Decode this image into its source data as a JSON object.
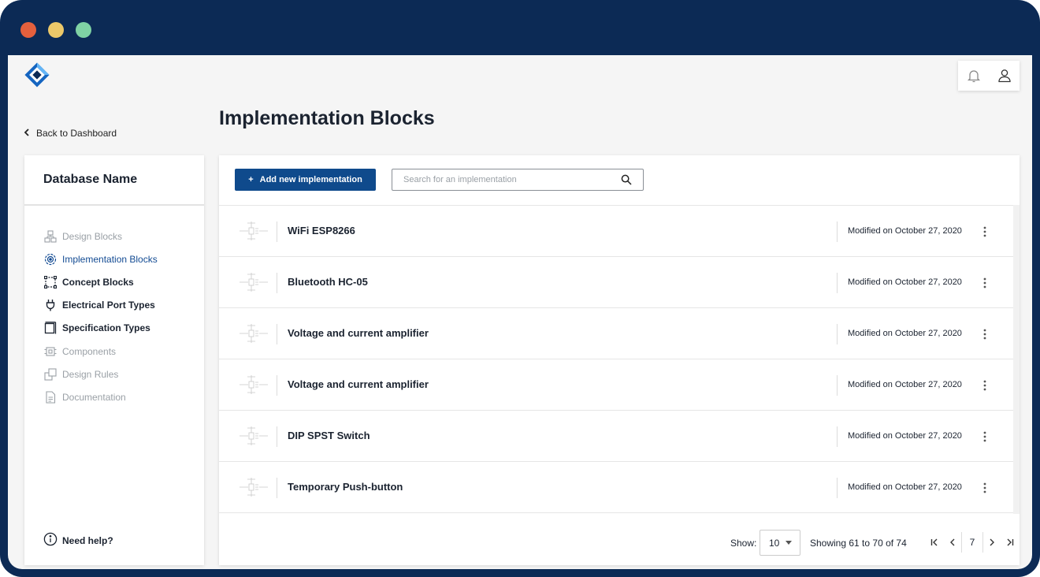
{
  "window": {
    "title_dots": [
      "close",
      "minimize",
      "maximize"
    ]
  },
  "brand": {
    "logo_icon": "diamond-logo-icon",
    "accent": "#0f4a8c"
  },
  "header": {
    "bell_icon": "bell-icon",
    "user_icon": "user-icon"
  },
  "back_link": {
    "label": "Back to Dashboard",
    "icon": "chevron-left-icon"
  },
  "page": {
    "title": "Implementation Blocks"
  },
  "sidebar": {
    "db_name": "Database Name",
    "items": [
      {
        "label": "Design Blocks",
        "icon": "design-blocks-icon",
        "state": "disabled"
      },
      {
        "label": "Implementation Blocks",
        "icon": "implementation-blocks-icon",
        "state": "active"
      },
      {
        "label": "Concept Blocks",
        "icon": "concept-blocks-icon",
        "state": "enabled"
      },
      {
        "label": "Electrical Port Types",
        "icon": "plug-icon",
        "state": "enabled"
      },
      {
        "label": "Specification Types",
        "icon": "specification-icon",
        "state": "enabled"
      },
      {
        "label": "Components",
        "icon": "chip-icon",
        "state": "disabled"
      },
      {
        "label": "Design Rules",
        "icon": "design-rules-icon",
        "state": "disabled"
      },
      {
        "label": "Documentation",
        "icon": "document-icon",
        "state": "disabled"
      }
    ],
    "help_label": "Need help?"
  },
  "toolbar": {
    "add_label": "Add new implementation",
    "search_placeholder": "Search for an implementation",
    "search_value": ""
  },
  "rows": [
    {
      "name": "WiFi ESP8266",
      "modified": "Modified on October 27, 2020"
    },
    {
      "name": "Bluetooth HC-05",
      "modified": "Modified on October 27, 2020"
    },
    {
      "name": "Voltage and current amplifier",
      "modified": "Modified on October 27, 2020"
    },
    {
      "name": "Voltage and current amplifier",
      "modified": "Modified on October 27, 2020"
    },
    {
      "name": "DIP SPST Switch",
      "modified": "Modified on October 27, 2020"
    },
    {
      "name": "Temporary Push-button",
      "modified": "Modified on October 27, 2020"
    }
  ],
  "pagination": {
    "show_label": "Show:",
    "page_size": "10",
    "range_text": "Showing 61 to 70 of 74",
    "current_page": "7"
  }
}
